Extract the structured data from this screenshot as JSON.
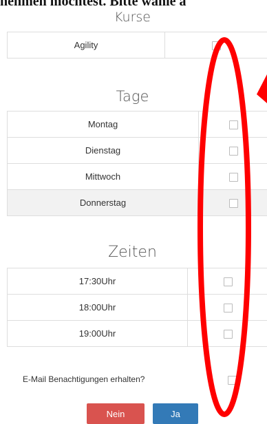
{
  "header": {
    "cut_text": "nehmen möchtest. Bitte wähle a"
  },
  "kurse": {
    "title": "Kurse",
    "rows": [
      {
        "label": "Agility"
      }
    ]
  },
  "tage": {
    "title": "Tage",
    "rows": [
      {
        "label": "Montag"
      },
      {
        "label": "Dienstag"
      },
      {
        "label": "Mittwoch"
      },
      {
        "label": "Donnerstag"
      }
    ]
  },
  "zeiten": {
    "title": "Zeiten",
    "rows": [
      {
        "label": "17:30Uhr"
      },
      {
        "label": "18:00Uhr"
      },
      {
        "label": "19:00Uhr"
      }
    ]
  },
  "email": {
    "label": "E-Mail Benachtigungen erhalten?"
  },
  "buttons": {
    "no_label": "Nein",
    "yes_label": "Ja"
  },
  "colors": {
    "annotation": "#ff0000",
    "no_button": "#d9534f",
    "yes_button": "#337ab7"
  }
}
